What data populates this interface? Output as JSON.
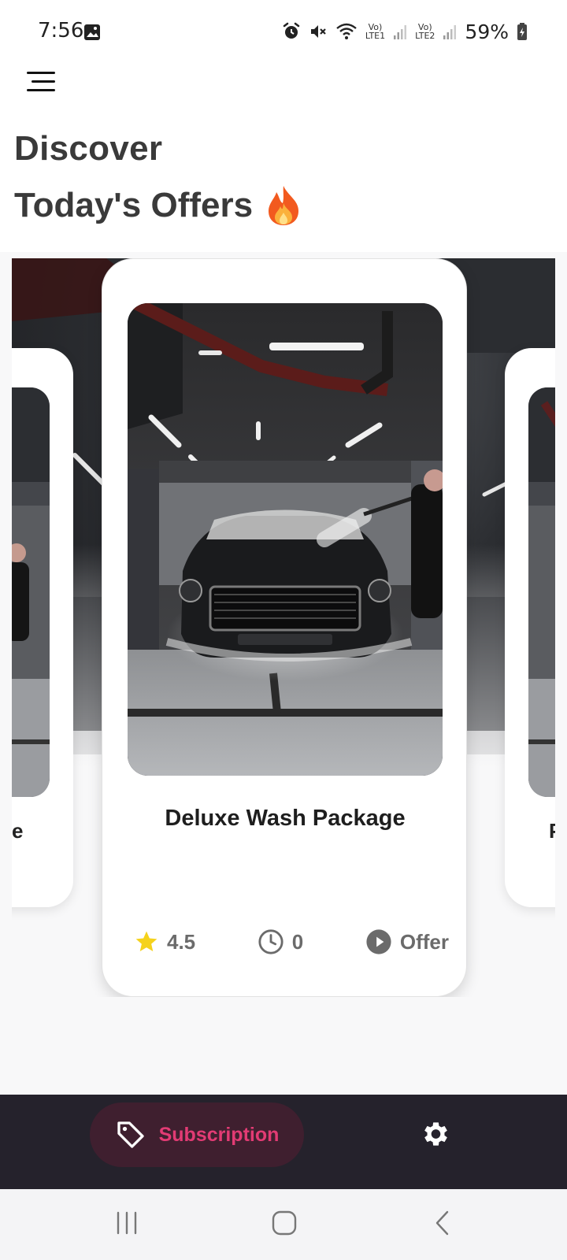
{
  "status_bar": {
    "time": "7:56",
    "battery": "59%",
    "lte1_top": "Vo)",
    "lte1_bottom": "LTE1",
    "lte2_top": "Vo)",
    "lte2_bottom": "LTE2",
    "icons": [
      "image-icon",
      "alarm-icon",
      "mute-icon",
      "wifi-icon",
      "signal-icon",
      "battery-icon"
    ]
  },
  "header": {
    "title_line1": "Discover",
    "title_line2": "Today's Offers",
    "emoji": "🔥"
  },
  "carousel": {
    "left_card_fragment": "e",
    "right_card_fragment": "P",
    "main_card": {
      "title": "Deluxe Wash Package",
      "rating": "4.5",
      "duration": "0",
      "type": "Offer"
    }
  },
  "bottom_nav": {
    "subscription_label": "Subscription",
    "accent": "#e23b74"
  }
}
